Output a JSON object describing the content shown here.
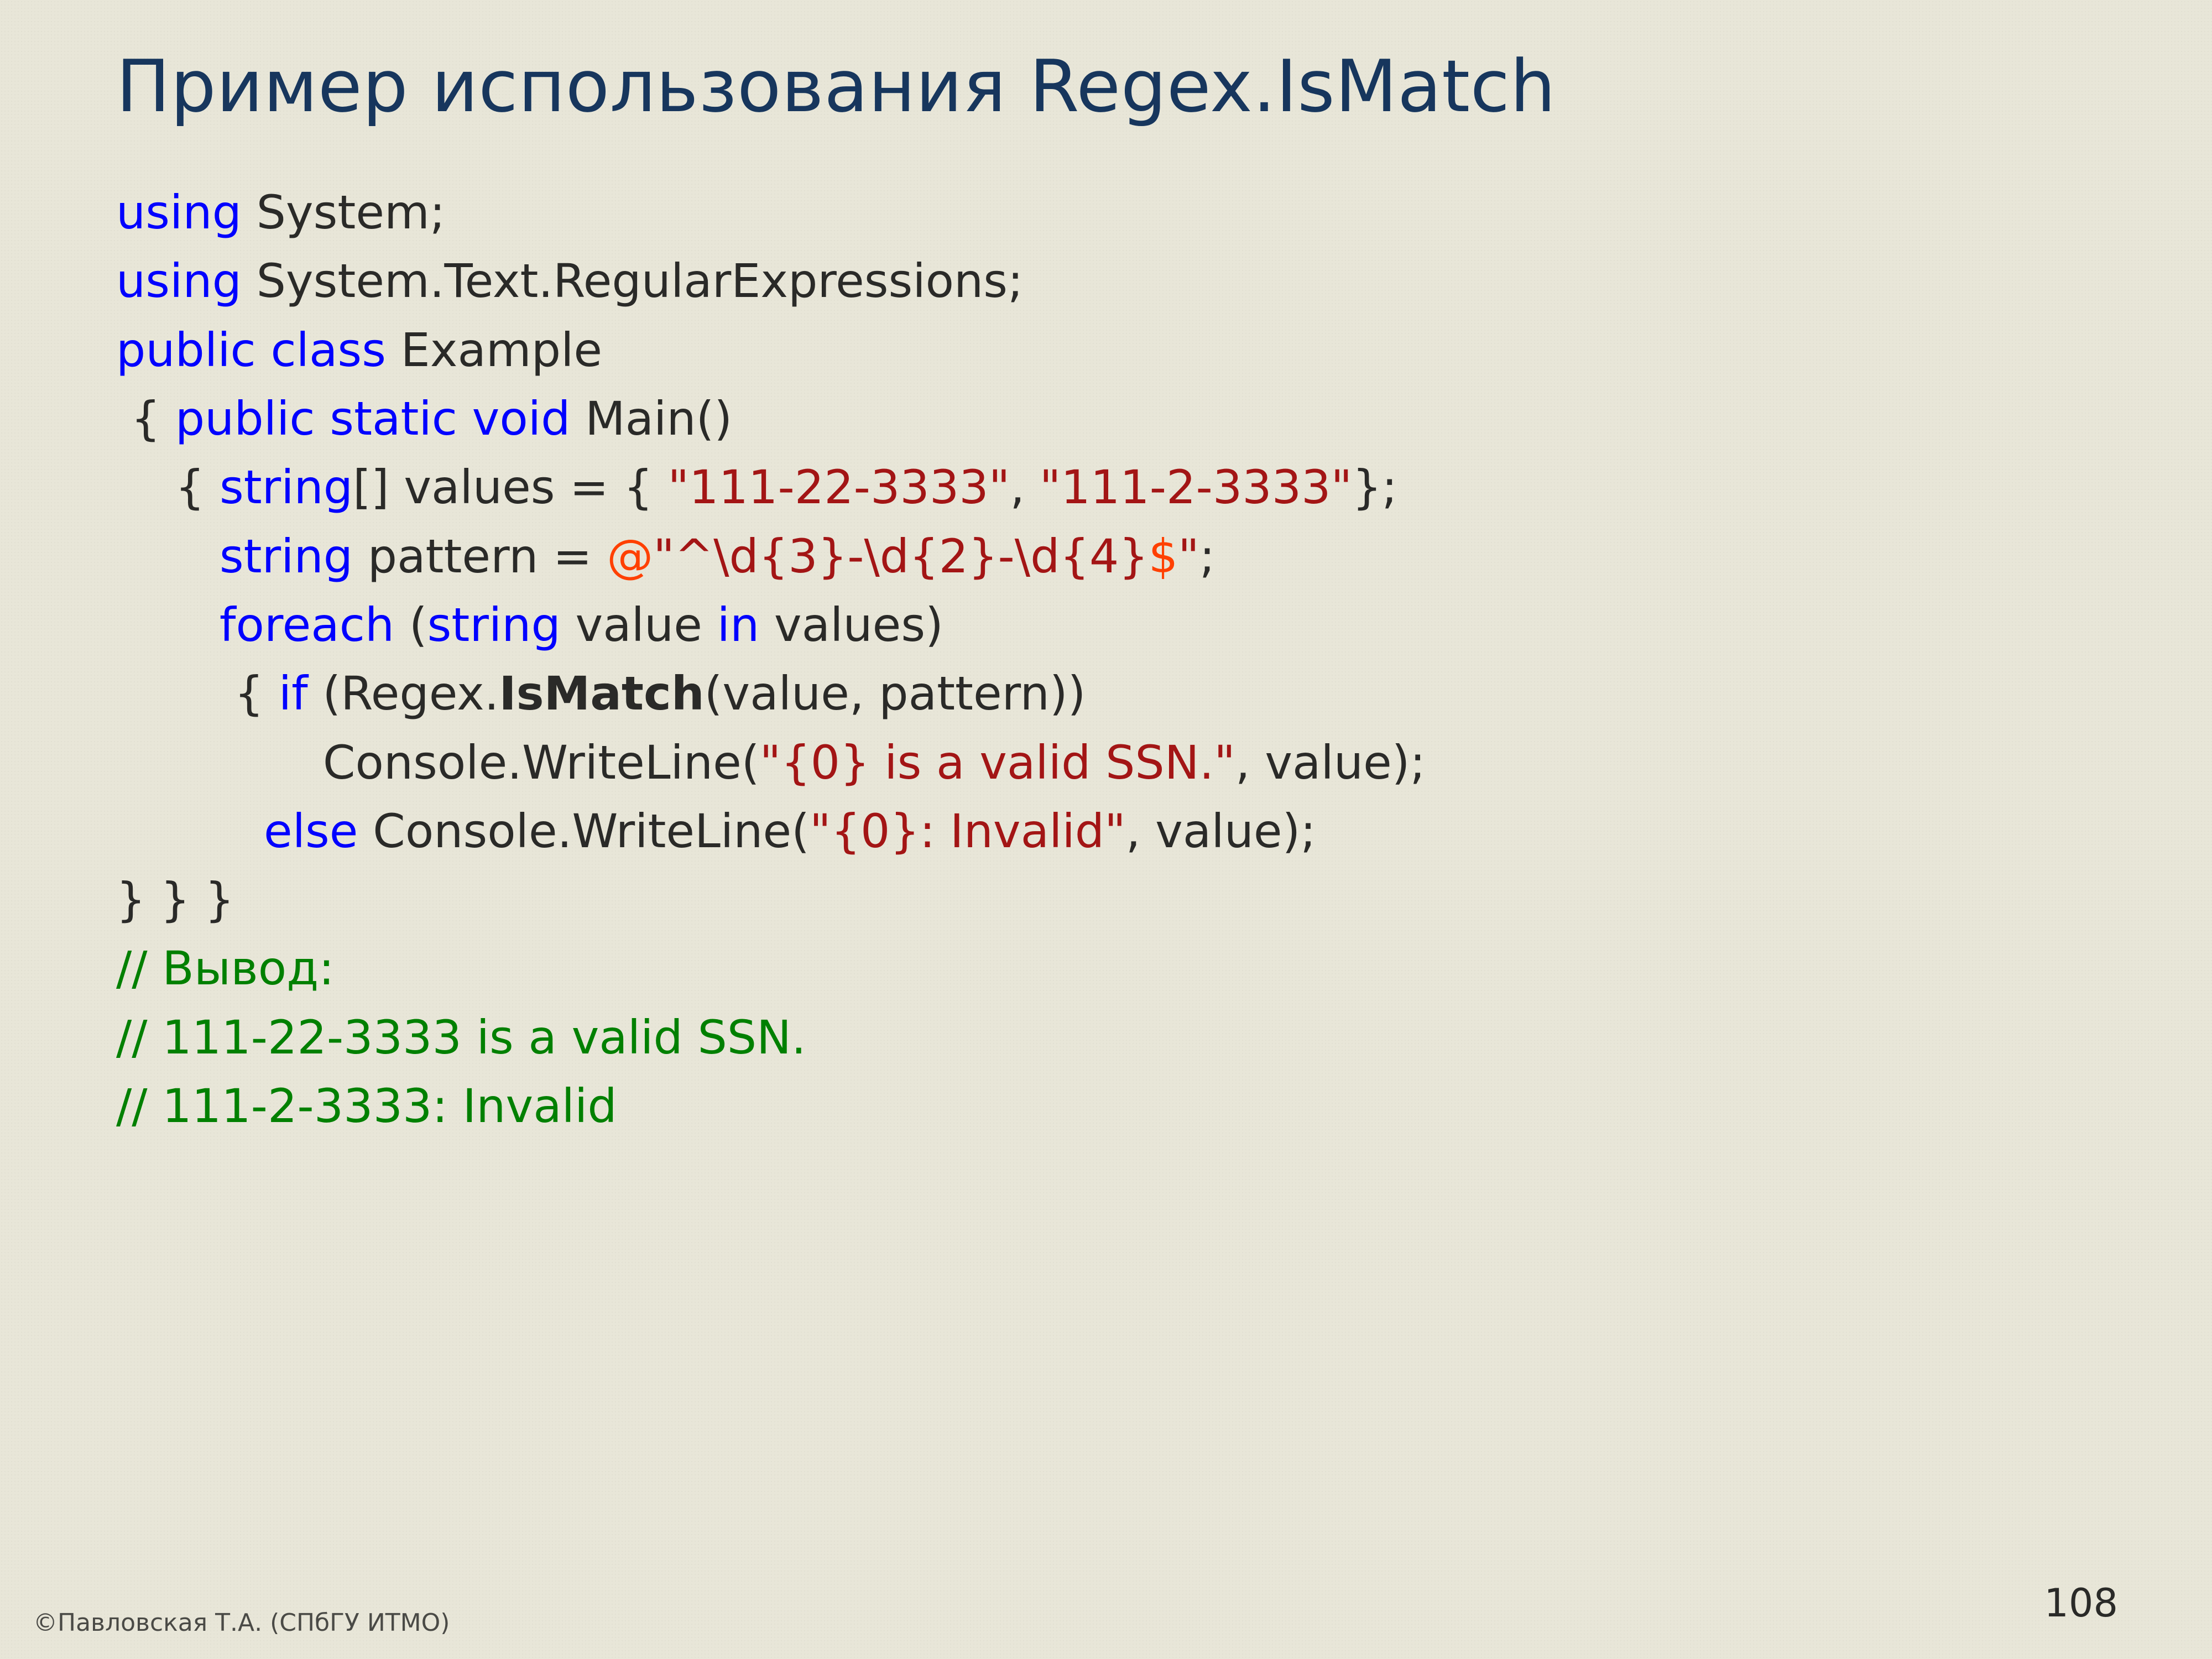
{
  "title": "Пример использования Regex.IsMatch",
  "code": {
    "l1": {
      "kw": "using",
      "rest": " System;"
    },
    "l2": {
      "kw": "using",
      "rest": " System.Text.RegularExpressions;"
    },
    "l3": {
      "kw": "public class",
      "rest": " Example"
    },
    "l4": {
      "pre": " { ",
      "kw": "public static void",
      "rest": " Main()"
    },
    "l5": {
      "pre": "    { ",
      "kw": "string",
      "mid": "[] values = { ",
      "s1": "\"111-22-3333\"",
      "comma": ", ",
      "s2": "\"111-2-3333\"",
      "end": "};"
    },
    "l6": {
      "pre": "       ",
      "kw": "string",
      "mid": " pattern = ",
      "at": "@",
      "q1": "\"^",
      "p1": "\\d{3}",
      "d1": "-",
      "p2": "\\d{2}",
      "d2": "-",
      "p3": "\\d{4}",
      "dollar": "$",
      "q2": "\"",
      "end": ";"
    },
    "l7": {
      "pre": "       ",
      "kw1": "foreach",
      "mid1": " (",
      "kw2": "string",
      "mid2": " value ",
      "kw3": "in",
      "mid3": " values)"
    },
    "l8": {
      "pre": "        { ",
      "kw": "if",
      "mid1": " (Regex.",
      "bold": "IsMatch",
      "mid2": "(value, pattern))"
    },
    "l9": {
      "pre": "              Console.WriteLine(",
      "s": "\"{0} is a valid SSN.\"",
      "end": ", value);"
    },
    "l10": {
      "pre": "          ",
      "kw": "else",
      "mid": " Console.WriteLine(",
      "s": "\"{0}: Invalid\"",
      "end": ", value);"
    },
    "l11": "} } }",
    "l12": "// Вывод:",
    "l13": "// 111-22-3333 is a valid SSN.",
    "l14": "// 111-2-3333: Invalid"
  },
  "footer": "©Павловская Т.А. (СПбГУ ИТМО)",
  "page": "108"
}
